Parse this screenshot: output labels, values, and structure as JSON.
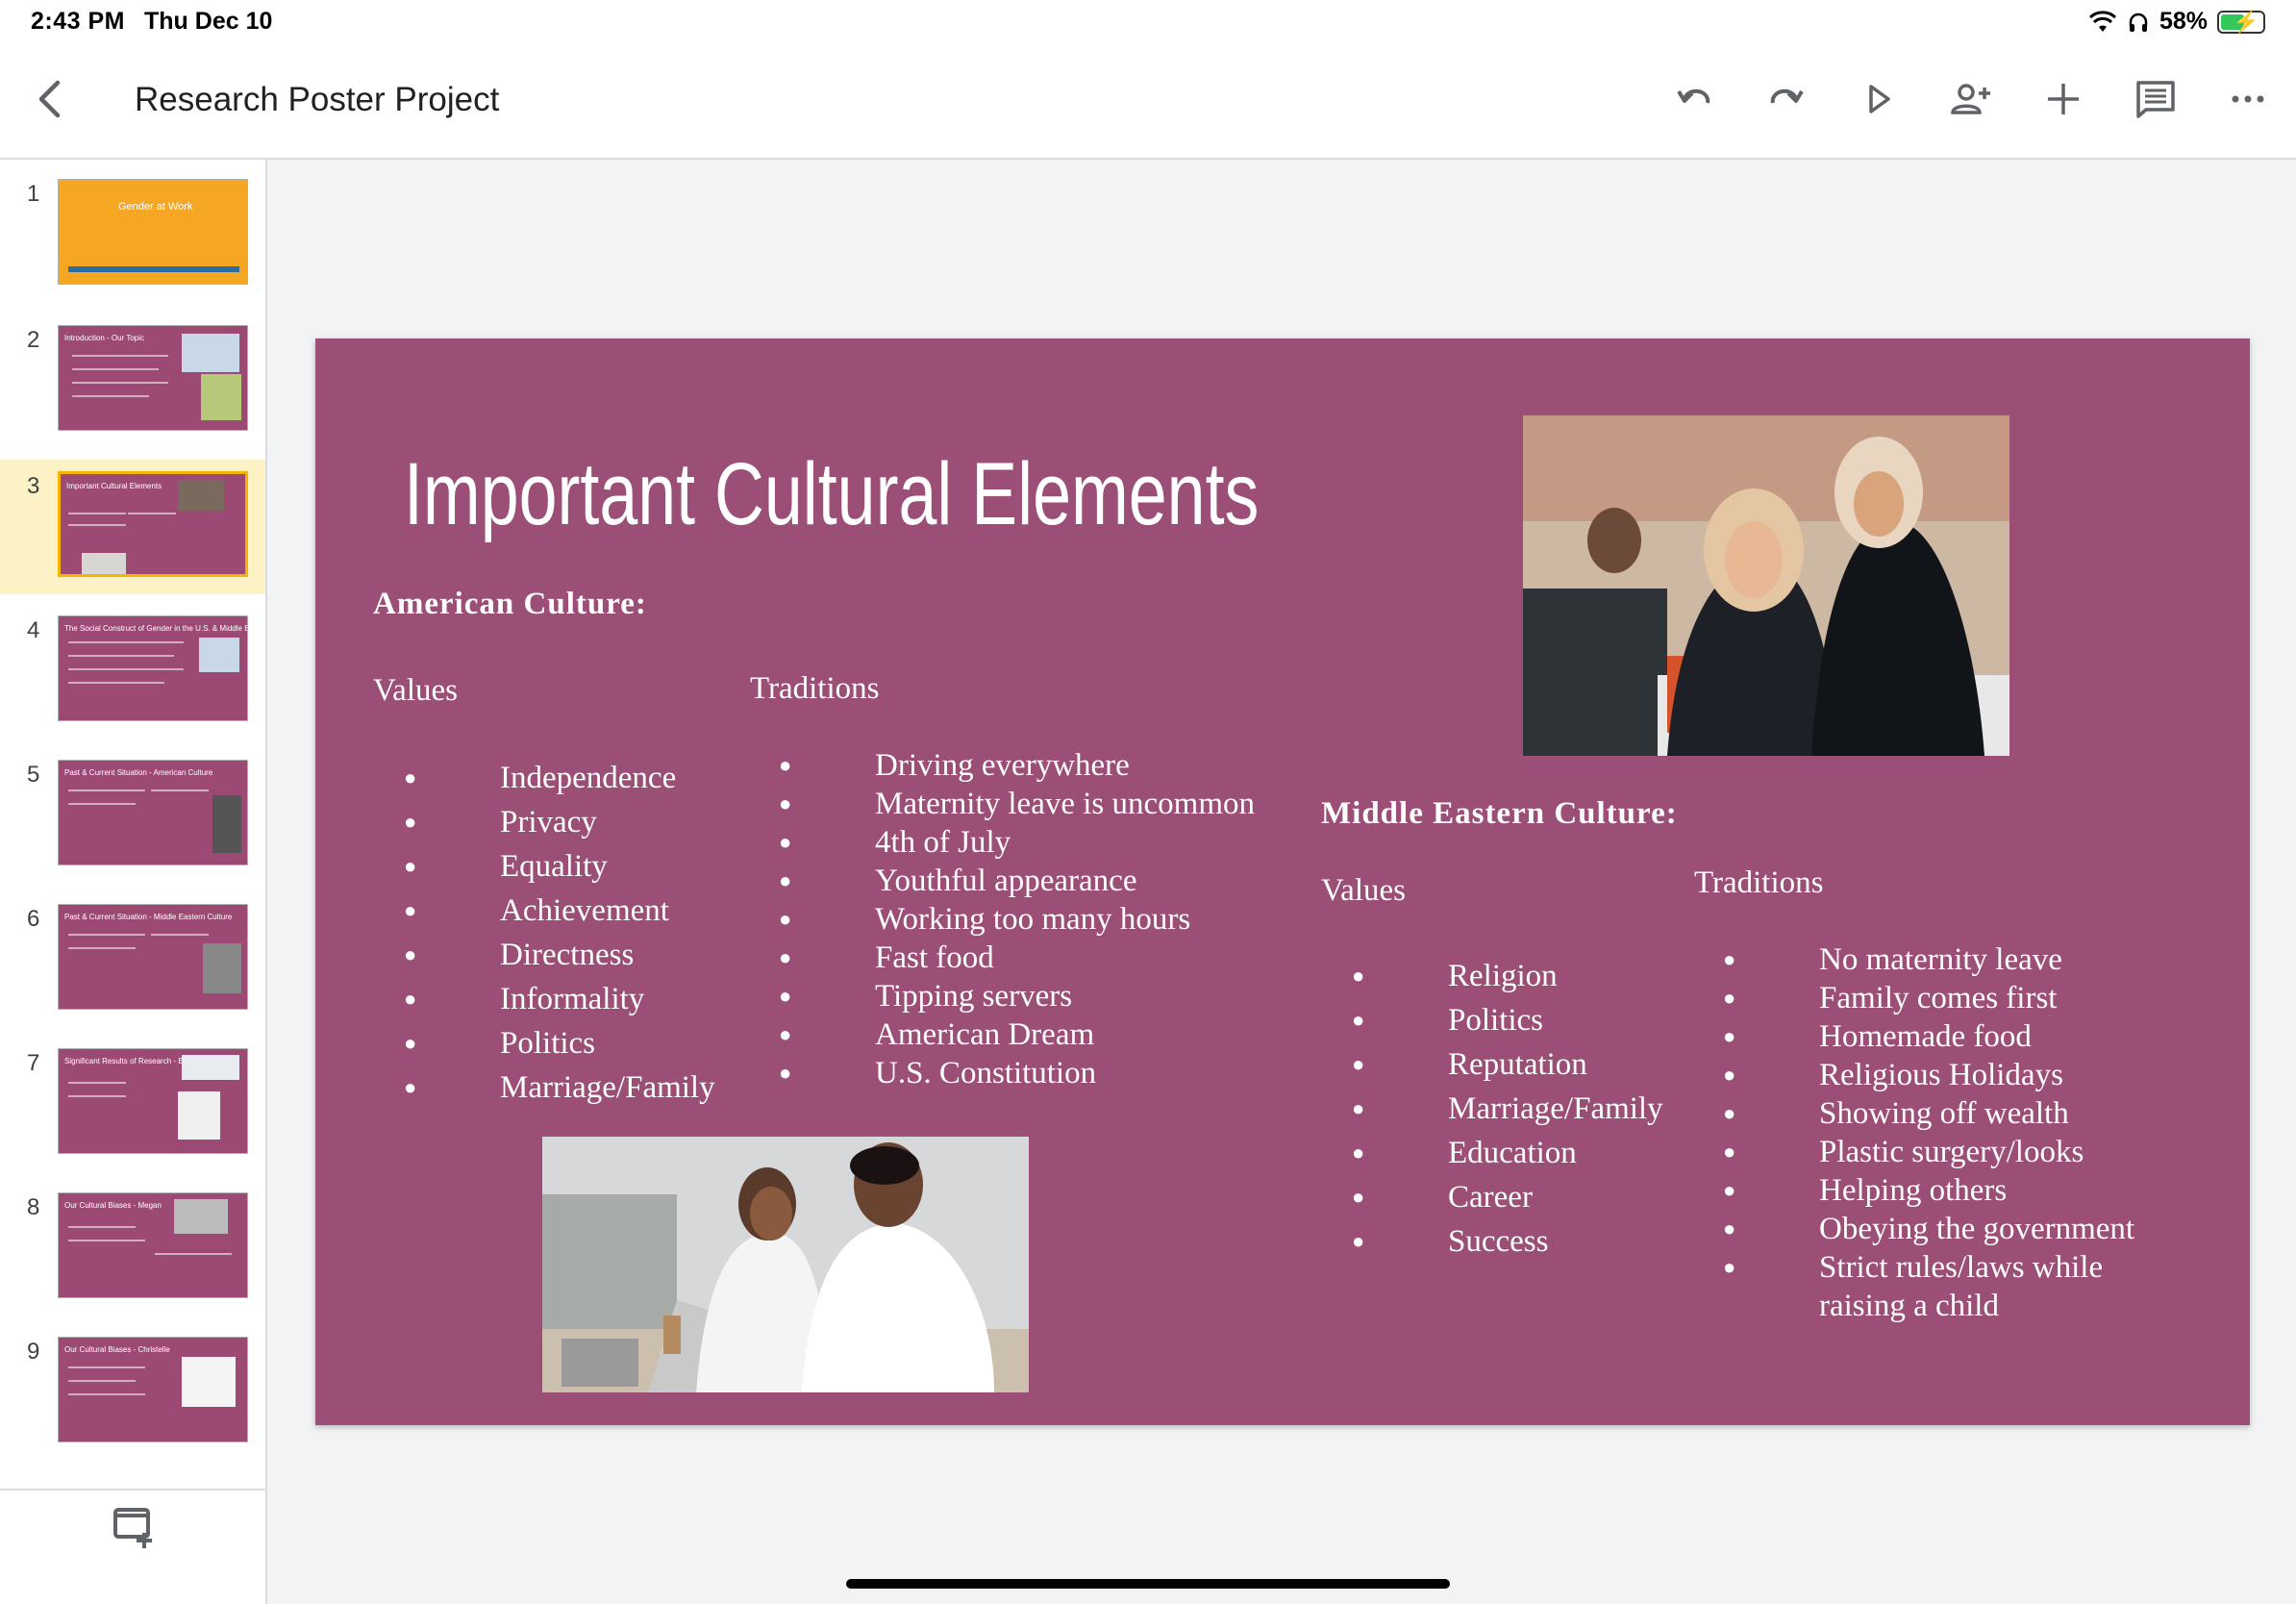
{
  "status_bar": {
    "time": "2:43 PM",
    "date": "Thu Dec 10",
    "battery": "58%",
    "battery_level": 0.58
  },
  "app_bar": {
    "title": "Research Poster Project",
    "icons": [
      "back-icon",
      "undo-icon",
      "redo-icon",
      "play-icon",
      "add-person-icon",
      "add-icon",
      "comment-icon",
      "more-icon"
    ]
  },
  "slides": [
    {
      "number": "1",
      "title": "Gender at Work"
    },
    {
      "number": "2",
      "title": "Introduction - Our Topic"
    },
    {
      "number": "3",
      "title": "Important Cultural Elements"
    },
    {
      "number": "4",
      "title": "The Social Construct of Gender in the U.S. & Middle East"
    },
    {
      "number": "5",
      "title": "Past & Current Situation - American Culture"
    },
    {
      "number": "6",
      "title": "Past & Current Situation - Middle Eastern Culture"
    },
    {
      "number": "7",
      "title": "Significant Results of Research - Both"
    },
    {
      "number": "8",
      "title": "Our Cultural Biases - Megan"
    },
    {
      "number": "9",
      "title": "Our Cultural Biases - Christelle"
    }
  ],
  "selected_slide": 3,
  "current_slide": {
    "title": "Important Cultural Elements",
    "american": {
      "heading": "American Culture:",
      "values_label": "Values",
      "traditions_label": "Traditions",
      "values": [
        "Independence",
        "Privacy",
        "Equality",
        "Achievement",
        "Directness",
        "Informality",
        "Politics",
        "Marriage/Family"
      ],
      "traditions": [
        "Driving everywhere",
        "Maternity leave is uncommon",
        "4th of July",
        "Youthful appearance",
        "Working too many hours",
        "Fast food",
        "Tipping servers",
        "American Dream",
        "U.S. Constitution"
      ]
    },
    "middle_eastern": {
      "heading": "Middle Eastern Culture:",
      "values_label": "Values",
      "traditions_label": "Traditions",
      "values": [
        "Religion",
        "Politics",
        "Reputation",
        "Marriage/Family",
        "Education",
        "Career",
        "Success"
      ],
      "traditions": [
        "No maternity leave",
        "Family comes first",
        "Homemade food",
        "Religious Holidays",
        "Showing off wealth",
        "Plastic surgery/looks",
        "Helping others",
        "Obeying the government",
        "Strict rules/laws while raising a child"
      ]
    },
    "slide_color": "#9c4f76"
  }
}
